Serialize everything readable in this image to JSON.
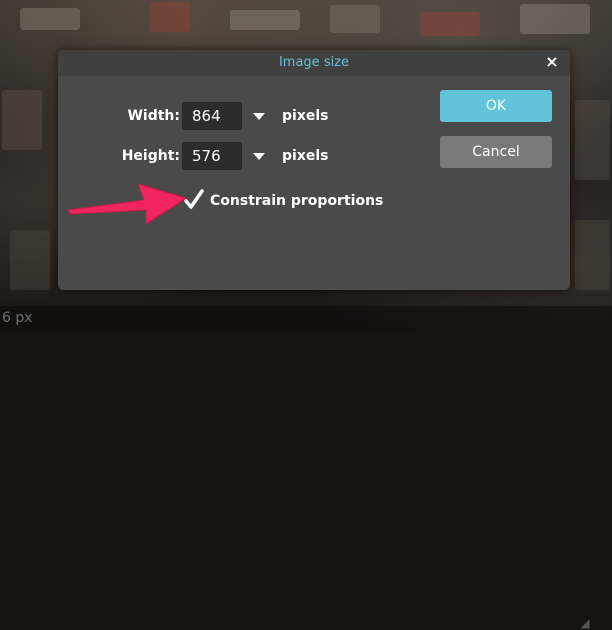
{
  "dialog": {
    "title": "Image size",
    "close_symbol": "×",
    "width_label": "Width:",
    "width_value": "864",
    "width_unit": "pixels",
    "height_label": "Height:",
    "height_value": "576",
    "height_unit": "pixels",
    "constrain_label": "Constrain proportions",
    "constrain_checked": true,
    "ok_label": "OK",
    "cancel_label": "Cancel"
  },
  "status": {
    "zoom_text": "6 px"
  },
  "colors": {
    "accent": "#64c3d6",
    "ok_button": "#62c4d8",
    "annotation_arrow": "#f0245e"
  },
  "icons": {
    "close": "close-icon",
    "dropdown": "chevron-down-icon",
    "check": "checkmark-icon",
    "annotation": "red-arrow-icon",
    "resize": "resize-grip-icon"
  }
}
